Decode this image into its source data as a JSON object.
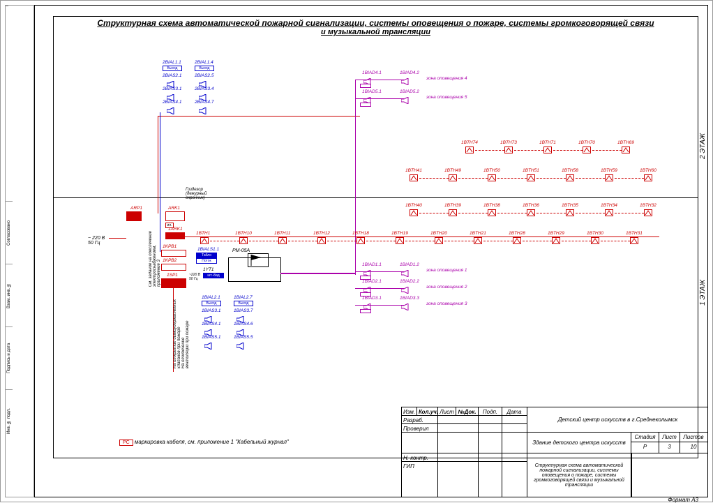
{
  "title": "Структурная схема автоматической пожарной сигнализации, системы оповещения о пожаре, системы громкоговорящей связи",
  "title2": "и музыкальной трансляции",
  "floors": {
    "f1": "1 ЭТАЖ",
    "f2": "2 ЭТАЖ"
  },
  "floor2_speakers": {
    "bial": [
      "2BIAL1.1",
      "2BIAL1.4",
      "2BIAS2.1",
      "2BIAS2.5",
      "2BIAS3.1",
      "2BIAS3.4",
      "2BIAS4.1",
      "2BIAS4.7"
    ],
    "biad": [
      "1BIAD4.1",
      "1BIAD4.2",
      "1BIAD5.1",
      "1BIAD5.2"
    ],
    "zones": [
      "зона оповещения 4",
      "зона оповещения 5"
    ]
  },
  "detectors_row1": [
    "1BTH74",
    "1BTH73",
    "1BTH71",
    "1BTH70",
    "1BTH69"
  ],
  "detectors_row2": [
    "1BTH41",
    "1BTH49",
    "1BTH50",
    "1BTH51",
    "1BTH58",
    "1BTH59",
    "1BTH60"
  ],
  "detectors_row3": [
    "1BTH40",
    "1BTH39",
    "1BTH38",
    "1BTH36",
    "1BTH35",
    "1BTH34",
    "1BTH32"
  ],
  "detectors_row4": [
    "1BTH1",
    "1BTH10",
    "1BTH11",
    "1BTH12",
    "1BTH18",
    "1BTH19",
    "1BTH20",
    "1BTH21",
    "1BTH28",
    "1BTH29",
    "1BTH30",
    "1BTH31"
  ],
  "floor1_biad": [
    "1BIAD1.1",
    "1BIAD1.2",
    "1BIAD2.1",
    "1BIAD2.2",
    "1BIAD3.1",
    "1BIAD3.3"
  ],
  "floor1_zones": [
    "зона оповещения 1",
    "зона оповещения 2",
    "зона оповещения 3"
  ],
  "floor1_bial": [
    "1BIAL2.1",
    "1BIAL2.7",
    "1BIAS3.1",
    "1BIAS3.7",
    "1BIAS4.1",
    "1BIAS4.6",
    "1BIAS5.1",
    "1BIAS5.5"
  ],
  "equipment": {
    "arp1": "ARP1",
    "ark1": "ARK1",
    "iark1": "1ARK1",
    "kpb1": "1KPB1",
    "kpb2": "1KPB2",
    "isp1": "1SP1",
    "bials11": "1BIALS1.1",
    "yt1": "1YT1",
    "pm": "РМ-05А"
  },
  "power": "~ 220 В\n50 Гц",
  "power2": "~220 В\n50 Гц",
  "notes": {
    "gozdezor": "Гоздезор\n(дежурный\nохранник)",
    "vert1": "См. задание на обеспечение\nэлектроснабжением,\nприложение 3",
    "vert2": "На открытие дымоудержателных\nклапанов при пожаре\nНа отключение\nвентиляции при пожаре",
    "vyhod": "Выход",
    "tabl": "Табло",
    "potok": "Поток",
    "unit": "шт.-8ад"
  },
  "legend": {
    "box": "РС",
    "text": " маркировка кабеля, см. приложение 1 \"Кабельный журнал\""
  },
  "titleblock": {
    "headers": [
      "Изм.",
      "Кол.уч.",
      "Лист",
      "№Док.",
      "Подп.",
      "Дата"
    ],
    "rows": [
      "Разраб.",
      "Проверил",
      "",
      "Н. контр.",
      "ГИП"
    ],
    "project": "Детский центр искусств в г.Среднеколымск",
    "object": "Здание детского центра искусств",
    "drawing": "Структурная схема автоматической пожарной сигнализации, системы оповещения о пожаре, системы громкоговорящей связи и музыкальной трансляции",
    "stage_h": "Стадия",
    "sheet_h": "Лист",
    "sheets_h": "Листов",
    "stage": "Р",
    "sheet": "3",
    "sheets": "10"
  },
  "sidebar": [
    "Согласовано",
    "Взам. инв. №",
    "Подпись и дата",
    "Инв. № подл."
  ],
  "format": "Формат А3"
}
